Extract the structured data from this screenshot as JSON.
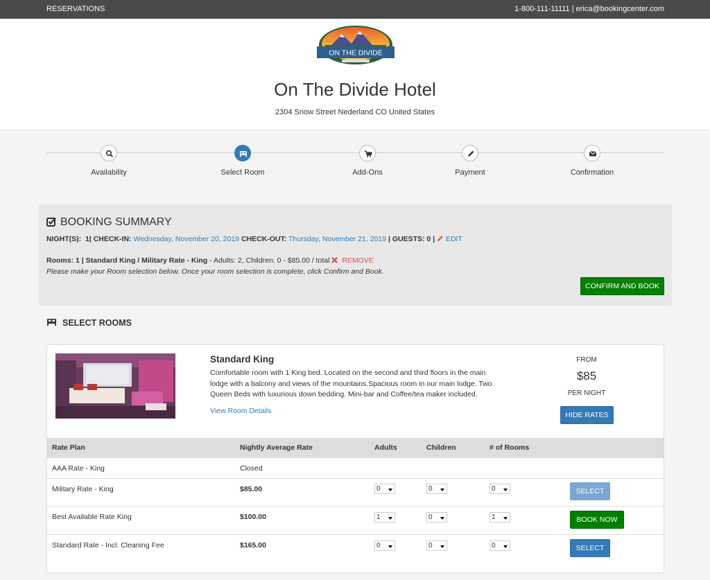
{
  "topbar": {
    "left": "RESERVATIONS",
    "phone": "1-800-111-11111 |",
    "email": "erica@bookingcenter.com"
  },
  "logo": {
    "text": "ON THE DIVIDE"
  },
  "hotel": {
    "name": "On The Divide Hotel",
    "address": "2304 Snow Street Nederland CO United States"
  },
  "steps": [
    {
      "label": "Availability",
      "icon": "search-icon"
    },
    {
      "label": "Select Room",
      "icon": "bed-icon",
      "active": true
    },
    {
      "label": "Add-Ons",
      "icon": "cart-icon"
    },
    {
      "label": "Payment",
      "icon": "pencil-icon"
    },
    {
      "label": "Confirmation",
      "icon": "envelope-icon"
    }
  ],
  "summary": {
    "title": "BOOKING SUMMARY",
    "nights_label": "NIGHT(S):",
    "nights": "1|",
    "checkin_label": "CHECK-IN:",
    "checkin": "Wednesday, November 20, 2019",
    "checkout_label": "CHECK-OUT:",
    "checkout": "Thursday, November 21, 2019",
    "guests_label": "| GUESTS: 0 |",
    "edit": "EDIT",
    "rooms_bold": "Rooms: 1 | Standard King / Military Rate - King",
    "rooms_rest": " - Adults: 2, Children: 0 - $85.00 / total ",
    "remove": "REMOVE",
    "note": "Please make your Room selection below. Once your room selection is complete, click Confirm and Book.",
    "confirm_button": "CONFIRM AND BOOK"
  },
  "select_rooms": {
    "title": "SELECT ROOMS"
  },
  "room": {
    "name": "Standard King",
    "description": "Comfortable room with 1 King bed. Located on the second and third floors in the main lodge with a balcony and views of the mountains.Spacious room in our main lodge. Two Queen Beds with luxurious down bedding. Mini-bar and Coffee/tea maker included.",
    "details_link": "View Room Details",
    "from": "FROM",
    "price": "$85",
    "per_night": "PER NIGHT",
    "hide_rates": "HIDE RATES"
  },
  "rates": {
    "headers": [
      "Rate Plan",
      "Nightly Average Rate",
      "Adults",
      "Children",
      "# of Rooms"
    ],
    "rows": [
      {
        "plan": "AAA Rate - King",
        "rate": "Closed"
      },
      {
        "plan": "Military Rate - King",
        "rate": "$85.00",
        "adults": "0",
        "children": "0",
        "rooms": "0",
        "button": "SELECT"
      },
      {
        "plan": "Best Available Rate King",
        "rate": "$100.00",
        "adults": "1",
        "children": "0",
        "rooms": "1",
        "button": "BOOK NOW"
      },
      {
        "plan": "Standard Rate - Incl. Cleaning Fee",
        "rate": "$165.00",
        "adults": "0",
        "children": "0",
        "rooms": "0",
        "button": "SELECT"
      }
    ]
  },
  "colors": {
    "primary": "#337ab7",
    "success": "#008000",
    "danger": "#d9534f",
    "topbar": "#4a4a4a"
  }
}
